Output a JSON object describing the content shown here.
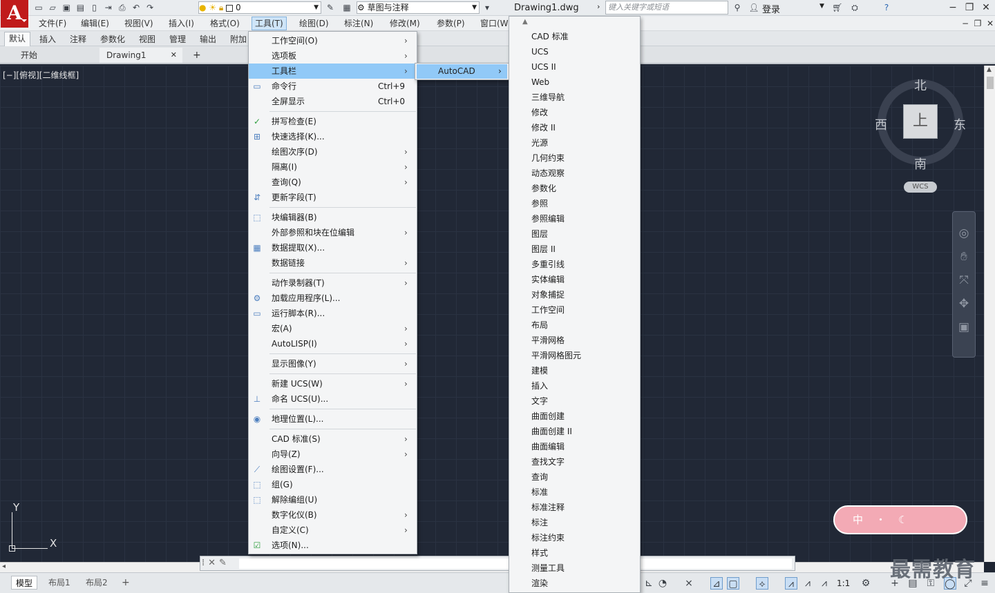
{
  "app": {
    "logo_letter": "A",
    "document_title": "Drawing1.dwg",
    "search_placeholder": "键入关键字或短语",
    "login_label": "登录",
    "layer_value": "0",
    "workspace_value": "草图与注释"
  },
  "menubar": [
    "文件(F)",
    "编辑(E)",
    "视图(V)",
    "插入(I)",
    "格式(O)",
    "工具(T)",
    "绘图(D)",
    "标注(N)",
    "修改(M)",
    "参数(P)",
    "窗口(W"
  ],
  "ribbon_tabs": [
    "默认",
    "插入",
    "注释",
    "参数化",
    "视图",
    "管理",
    "输出",
    "附加"
  ],
  "file_tabs": {
    "start": "开始",
    "drawing": "Drawing1",
    "close": "✕",
    "new": "+"
  },
  "viewport": {
    "view_label": "[−][俯视][二维线框]",
    "compass": {
      "north": "北",
      "south": "南",
      "east": "东",
      "west": "西",
      "top_face": "上"
    },
    "wcs_label": "WCS",
    "ucs_x": "X",
    "ucs_y": "Y"
  },
  "tools_menu": [
    {
      "label": "工作空间(O)",
      "submenu": true
    },
    {
      "label": "选项板",
      "submenu": true
    },
    {
      "label": "工具栏",
      "submenu": true,
      "highlighted": true
    },
    {
      "label": "命令行",
      "shortcut": "Ctrl+9",
      "icon": "command-line-icon"
    },
    {
      "label": "全屏显示",
      "shortcut": "Ctrl+0"
    },
    {
      "separator": true
    },
    {
      "label": "拼写检查(E)",
      "icon": "spell-check-icon"
    },
    {
      "label": "快速选择(K)...",
      "icon": "quick-select-icon"
    },
    {
      "label": "绘图次序(D)",
      "submenu": true
    },
    {
      "label": "隔离(I)",
      "submenu": true
    },
    {
      "label": "查询(Q)",
      "submenu": true
    },
    {
      "label": "更新字段(T)",
      "icon": "update-field-icon"
    },
    {
      "separator": true
    },
    {
      "label": "块编辑器(B)",
      "icon": "block-editor-icon"
    },
    {
      "label": "外部参照和块在位编辑",
      "submenu": true
    },
    {
      "label": "数据提取(X)...",
      "icon": "data-extraction-icon"
    },
    {
      "label": "数据链接",
      "submenu": true
    },
    {
      "separator": true
    },
    {
      "label": "动作录制器(T)",
      "submenu": true
    },
    {
      "label": "加载应用程序(L)...",
      "icon": "load-application-icon"
    },
    {
      "label": "运行脚本(R)...",
      "icon": "run-script-icon"
    },
    {
      "label": "宏(A)",
      "submenu": true
    },
    {
      "label": "AutoLISP(I)",
      "submenu": true
    },
    {
      "separator": true
    },
    {
      "label": "显示图像(Y)",
      "submenu": true
    },
    {
      "separator": true
    },
    {
      "label": "新建 UCS(W)",
      "submenu": true
    },
    {
      "label": "命名 UCS(U)...",
      "icon": "named-ucs-icon"
    },
    {
      "separator": true
    },
    {
      "label": "地理位置(L)...",
      "icon": "globe-icon"
    },
    {
      "separator": true
    },
    {
      "label": "CAD 标准(S)",
      "submenu": true
    },
    {
      "label": "向导(Z)",
      "submenu": true
    },
    {
      "label": "绘图设置(F)...",
      "icon": "drafting-settings-icon"
    },
    {
      "label": "组(G)",
      "icon": "group-icon"
    },
    {
      "label": "解除编组(U)",
      "icon": "ungroup-icon"
    },
    {
      "label": "数字化仪(B)",
      "submenu": true
    },
    {
      "label": "自定义(C)",
      "submenu": true
    },
    {
      "label": "选项(N)...",
      "icon": "options-check-icon"
    }
  ],
  "toolbar_submenu": {
    "label": "AutoCAD"
  },
  "toolbar_list": [
    "CAD 标准",
    "UCS",
    "UCS II",
    "Web",
    "三维导航",
    "修改",
    "修改 II",
    "光源",
    "几何约束",
    "动态观察",
    "参数化",
    "参照",
    "参照编辑",
    "图层",
    "图层 II",
    "多重引线",
    "实体编辑",
    "对象捕捉",
    "工作空间",
    "布局",
    "平滑网格",
    "平滑网格图元",
    "建模",
    "插入",
    "文字",
    "曲面创建",
    "曲面创建 II",
    "曲面编辑",
    "查找文字",
    "查询",
    "标准",
    "标准注释",
    "标注",
    "标注约束",
    "样式",
    "测量工具",
    "渲染"
  ],
  "command_line": {
    "placeholder": ""
  },
  "layout_tabs": [
    "模型",
    "布局1",
    "布局2"
  ],
  "status": {
    "scale": "1:1"
  },
  "sticker": {
    "text": "中・☾"
  },
  "watermark": "最需教育",
  "colors": {
    "highlight": "#91c9f7",
    "canvas": "#212836",
    "logo": "#c01b1b"
  }
}
